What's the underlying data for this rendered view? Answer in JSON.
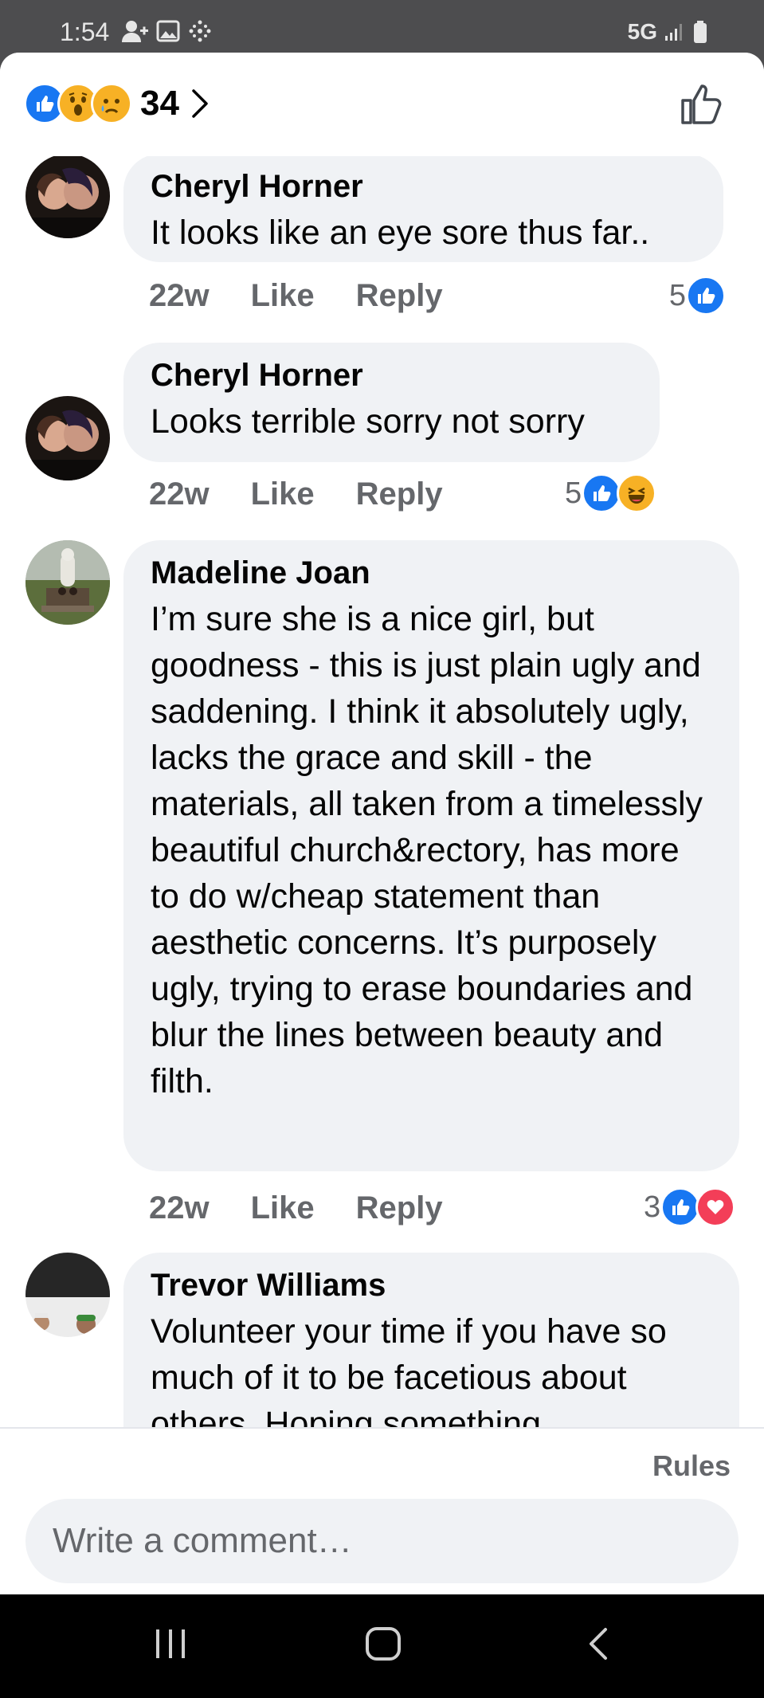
{
  "status_bar": {
    "time": "1:54",
    "network": "5G"
  },
  "header": {
    "reaction_count": "34"
  },
  "comments": [
    {
      "author": "Cheryl Horner",
      "text": "It looks like an eye sore thus far..",
      "time": "22w",
      "like_label": "Like",
      "reply_label": "Reply",
      "reaction_count": "5",
      "reactions": [
        "like"
      ]
    },
    {
      "author": "Cheryl Horner",
      "text": "Looks terrible sorry not sorry",
      "time": "22w",
      "like_label": "Like",
      "reply_label": "Reply",
      "reaction_count": "5",
      "reactions": [
        "like",
        "haha"
      ]
    },
    {
      "author": "Madeline Joan",
      "text": "I’m sure she is a nice girl, but goodness - this is just plain ugly and saddening. I think it absolutely ugly, lacks the grace and skill - the materials, all taken from a timelessly beautiful church&rectory, has more to do w/cheap statement than aesthetic concerns. It’s purposely ugly, trying to erase boundaries and blur the lines between beauty and filth.",
      "time": "22w",
      "like_label": "Like",
      "reply_label": "Reply",
      "reaction_count": "3",
      "reactions": [
        "like",
        "love"
      ]
    },
    {
      "author": "Trevor Williams",
      "text": "Volunteer your time if you have so much of it to be facetious about others. Hoping something"
    }
  ],
  "composer": {
    "rules_label": "Rules",
    "placeholder": "Write a comment…"
  },
  "colors": {
    "like_blue": "#1877f2",
    "love_red": "#f33e58",
    "haha_yellow": "#f7b125",
    "bubble_bg": "#f0f2f5",
    "meta_gray": "#65676b"
  }
}
